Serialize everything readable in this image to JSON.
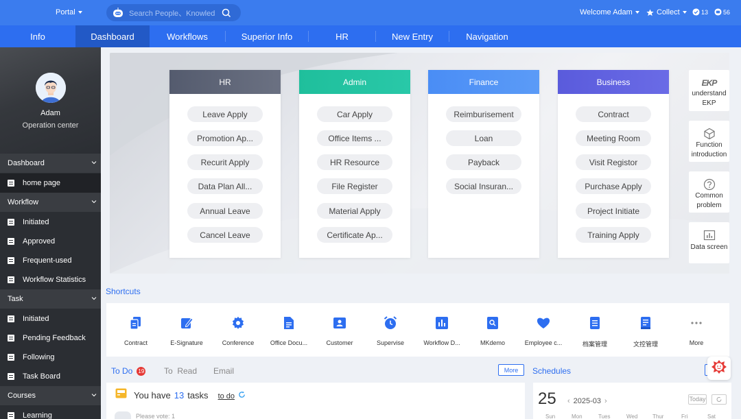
{
  "topbar": {
    "portal": "Portal",
    "search_placeholder": "Search People、Knowled",
    "welcome": "Welcome  Adam",
    "collect": "Collect",
    "badge1": "13",
    "badge2": "56"
  },
  "nav": {
    "tabs": [
      "Info",
      "Dashboard",
      "Workflows",
      "Superior Info",
      "HR",
      "New Entry",
      "Navigation"
    ],
    "active": "Dashboard"
  },
  "sidebar": {
    "user_name": "Adam",
    "user_role": "Operation center",
    "groups": [
      {
        "label": "Dashboard",
        "items": [
          "home page"
        ]
      },
      {
        "label": "Workflow",
        "items": [
          "Initiated",
          "Approved",
          "Frequent-used",
          "Workflow Statistics"
        ]
      },
      {
        "label": "Task",
        "items": [
          "Initiated",
          "Pending Feedback",
          "Following",
          "Task Board"
        ]
      },
      {
        "label": "Courses",
        "items": [
          "Learning"
        ]
      }
    ],
    "selected": "home page"
  },
  "cards": [
    {
      "title": "HR",
      "color": "#5c6375",
      "items": [
        "Leave Apply",
        "Promotion Ap...",
        "Recurit Apply",
        "Data Plan All...",
        "Annual Leave",
        "Cancel Leave"
      ]
    },
    {
      "title": "Admin",
      "color": "#21c0a0",
      "items": [
        "Car Apply",
        "Office Items ...",
        "HR Resource",
        "File Register",
        "Material Apply",
        "Certificate Ap..."
      ]
    },
    {
      "title": "Finance",
      "color": "#4b8ff5",
      "items": [
        "Reimburisement",
        "Loan",
        "Payback",
        "Social Insuran..."
      ]
    },
    {
      "title": "Business",
      "color": "#5e5fe0",
      "items": [
        "Contract",
        "Meeting Room",
        "Visit Registor",
        "Purchase Apply",
        "Project Initiate",
        "Training Apply"
      ]
    }
  ],
  "right_panel": [
    {
      "logo": "EKP",
      "label": "understand EKP",
      "icon": "ekp-logo-icon"
    },
    {
      "label": "Function introduction",
      "icon": "cube-icon"
    },
    {
      "label": "Common problem",
      "icon": "question-icon"
    },
    {
      "label": "Data screen",
      "icon": "bar-chart-icon"
    }
  ],
  "shortcuts": {
    "title": "Shortcuts",
    "items": [
      {
        "label": "Contract",
        "icon": "documents-icon"
      },
      {
        "label": "E-Signature",
        "icon": "pen-icon"
      },
      {
        "label": "Conference",
        "icon": "gear-icon"
      },
      {
        "label": "Office Docu...",
        "icon": "file-icon"
      },
      {
        "label": "Customer",
        "icon": "contact-card-icon"
      },
      {
        "label": "Supervise",
        "icon": "alarm-clock-icon"
      },
      {
        "label": "Workflow D...",
        "icon": "chart-icon"
      },
      {
        "label": "MKdemo",
        "icon": "search-doc-icon"
      },
      {
        "label": "Employee c...",
        "icon": "heart-icon"
      },
      {
        "label": "档案管理",
        "icon": "archive-icon"
      },
      {
        "label": "文控管理",
        "icon": "doc-control-icon"
      },
      {
        "label": "More",
        "icon": "more-dots-icon"
      }
    ]
  },
  "todo": {
    "tabs": [
      "To Do",
      "To  Read",
      "Email"
    ],
    "todo_count": "19",
    "more": "More",
    "message_prefix": "You have",
    "message_count": "13",
    "message_suffix": "tasks",
    "link": "to do",
    "vote": "Please vote: 1"
  },
  "schedules": {
    "title": "Schedules",
    "day": "25",
    "month": "2025-03",
    "today": "Today",
    "weekdays": [
      "Sun",
      "Mon",
      "Tues",
      "Wed",
      "Thur",
      "Fri",
      "Sat"
    ]
  },
  "colors": {
    "primary": "#3b7cee",
    "nav": "#2d6ef0",
    "sidebar": "#2b2e33",
    "accent_red": "#e53935"
  }
}
